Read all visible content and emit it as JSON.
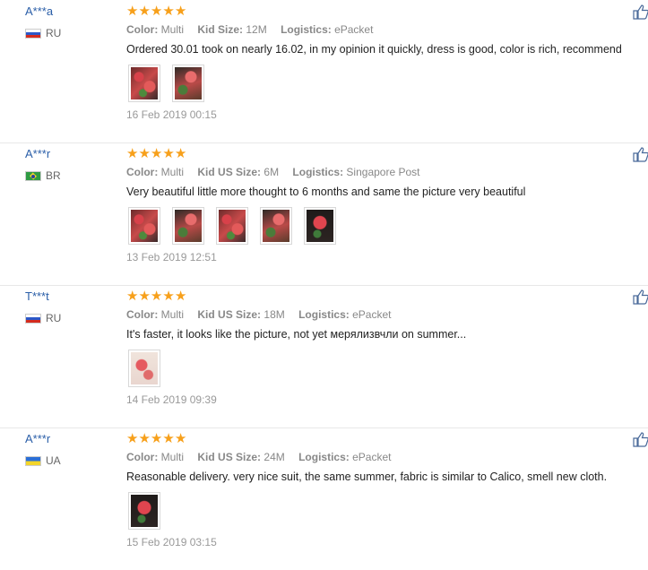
{
  "reviews": [
    {
      "user": "A***a",
      "country": "RU",
      "flag": "ru",
      "stars": 5,
      "attributes": [
        {
          "key": "Color:",
          "value": "Multi"
        },
        {
          "key": "Kid Size:",
          "value": "12M"
        },
        {
          "key": "Logistics:",
          "value": "ePacket"
        }
      ],
      "text": "Ordered 30.01 took on nearly 16.02, in my opinion it quickly, dress is good, color is rich, recommend",
      "photo_count": 2,
      "date": "16 Feb 2019 00:15"
    },
    {
      "user": "A***r",
      "country": "BR",
      "flag": "br",
      "stars": 5,
      "attributes": [
        {
          "key": "Color:",
          "value": "Multi"
        },
        {
          "key": "Kid US Size:",
          "value": "6M"
        },
        {
          "key": "Logistics:",
          "value": "Singapore Post"
        }
      ],
      "text": "Very beautiful little more thought to 6 months and same the picture very beautiful",
      "photo_count": 5,
      "date": "13 Feb 2019 12:51"
    },
    {
      "user": "T***t",
      "country": "RU",
      "flag": "ru",
      "stars": 5,
      "attributes": [
        {
          "key": "Color:",
          "value": "Multi"
        },
        {
          "key": "Kid US Size:",
          "value": "18M"
        },
        {
          "key": "Logistics:",
          "value": "ePacket"
        }
      ],
      "text": "It's faster, it looks like the picture, not yet мерялизвчли on summer...",
      "photo_count": 1,
      "date": "14 Feb 2019 09:39"
    },
    {
      "user": "A***r",
      "country": "UA",
      "flag": "ua",
      "stars": 5,
      "attributes": [
        {
          "key": "Color:",
          "value": "Multi"
        },
        {
          "key": "Kid US Size:",
          "value": "24M"
        },
        {
          "key": "Logistics:",
          "value": "ePacket"
        }
      ],
      "text": "Reasonable delivery. very nice suit, the same summer, fabric is similar to Calico, smell new cloth.",
      "photo_count": 1,
      "date": "15 Feb 2019 03:15"
    }
  ],
  "colors": {
    "username": "#2a5ea8",
    "star": "#f7a01b",
    "muted": "#888888",
    "date": "#999999"
  },
  "icons": {
    "star": "star-icon",
    "like": "thumbs-up-icon"
  }
}
